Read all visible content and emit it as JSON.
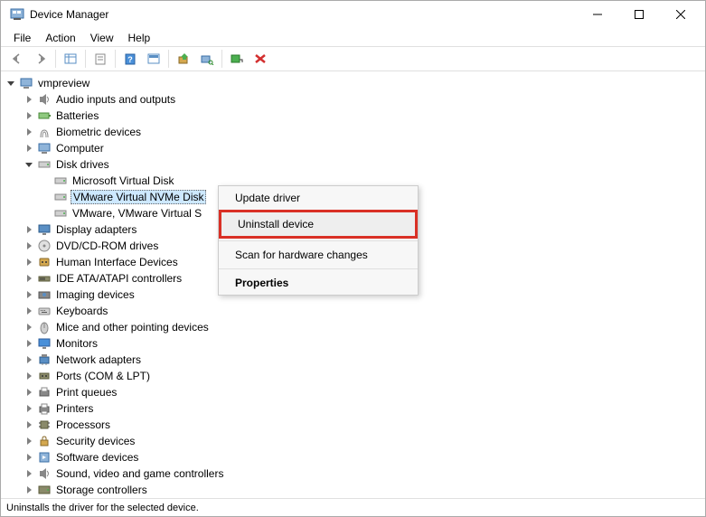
{
  "titlebar": {
    "title": "Device Manager"
  },
  "menubar": {
    "items": [
      "File",
      "Action",
      "View",
      "Help"
    ]
  },
  "tree": {
    "root": "vmpreview",
    "children": [
      {
        "label": "Audio inputs and outputs",
        "expanded": false,
        "icon": "audio"
      },
      {
        "label": "Batteries",
        "expanded": false,
        "icon": "battery"
      },
      {
        "label": "Biometric devices",
        "expanded": false,
        "icon": "biometric"
      },
      {
        "label": "Computer",
        "expanded": false,
        "icon": "computer"
      },
      {
        "label": "Disk drives",
        "expanded": true,
        "icon": "disk",
        "children": [
          {
            "label": "Microsoft Virtual Disk",
            "icon": "disk"
          },
          {
            "label": "VMware Virtual NVMe Disk",
            "icon": "disk",
            "selected": true
          },
          {
            "label": "VMware, VMware Virtual S",
            "icon": "disk"
          }
        ]
      },
      {
        "label": "Display adapters",
        "expanded": false,
        "icon": "display"
      },
      {
        "label": "DVD/CD-ROM drives",
        "expanded": false,
        "icon": "dvd"
      },
      {
        "label": "Human Interface Devices",
        "expanded": false,
        "icon": "hid"
      },
      {
        "label": "IDE ATA/ATAPI controllers",
        "expanded": false,
        "icon": "ide"
      },
      {
        "label": "Imaging devices",
        "expanded": false,
        "icon": "imaging"
      },
      {
        "label": "Keyboards",
        "expanded": false,
        "icon": "keyboard"
      },
      {
        "label": "Mice and other pointing devices",
        "expanded": false,
        "icon": "mouse"
      },
      {
        "label": "Monitors",
        "expanded": false,
        "icon": "monitor"
      },
      {
        "label": "Network adapters",
        "expanded": false,
        "icon": "network"
      },
      {
        "label": "Ports (COM & LPT)",
        "expanded": false,
        "icon": "port"
      },
      {
        "label": "Print queues",
        "expanded": false,
        "icon": "printqueue"
      },
      {
        "label": "Printers",
        "expanded": false,
        "icon": "printer"
      },
      {
        "label": "Processors",
        "expanded": false,
        "icon": "cpu"
      },
      {
        "label": "Security devices",
        "expanded": false,
        "icon": "security"
      },
      {
        "label": "Software devices",
        "expanded": false,
        "icon": "software"
      },
      {
        "label": "Sound, video and game controllers",
        "expanded": false,
        "icon": "sound"
      },
      {
        "label": "Storage controllers",
        "expanded": false,
        "icon": "storage"
      }
    ]
  },
  "context_menu": {
    "items": [
      {
        "label": "Update driver"
      },
      {
        "label": "Uninstall device",
        "highlight": true
      },
      {
        "sep": true
      },
      {
        "label": "Scan for hardware changes"
      },
      {
        "sep": true
      },
      {
        "label": "Properties",
        "bold": true
      }
    ]
  },
  "statusbar": {
    "text": "Uninstalls the driver for the selected device."
  }
}
